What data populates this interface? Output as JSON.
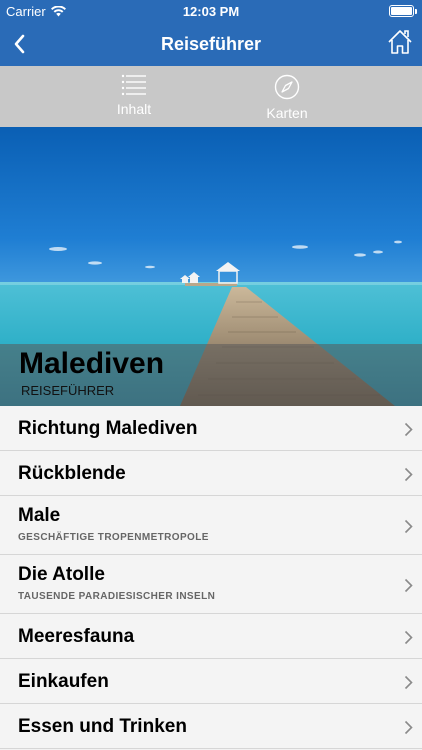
{
  "status_bar": {
    "carrier": "Carrier",
    "time": "12:03 PM",
    "battery_level": 1.0
  },
  "nav": {
    "title": "Reiseführer",
    "back_icon": "chevron-left-icon",
    "home_icon": "home-icon"
  },
  "toolbar": {
    "items": [
      {
        "label": "Inhalt",
        "icon": "list-icon"
      },
      {
        "label": "Karten",
        "icon": "compass-icon"
      }
    ]
  },
  "hero": {
    "title": "Malediven",
    "subtitle": "REISEFÜHRER"
  },
  "list": [
    {
      "title": "Richtung Malediven",
      "subtitle": ""
    },
    {
      "title": "Rückblende",
      "subtitle": ""
    },
    {
      "title": "Male",
      "subtitle": "GESCHÄFTIGE TROPENMETROPOLE"
    },
    {
      "title": "Die Atolle",
      "subtitle": "TAUSENDE PARADIESISCHER INSELN"
    },
    {
      "title": "Meeresfauna",
      "subtitle": ""
    },
    {
      "title": "Einkaufen",
      "subtitle": ""
    },
    {
      "title": "Essen und Trinken",
      "subtitle": ""
    }
  ],
  "colors": {
    "accent": "#2a6bb7",
    "toolbar": "#c8c8c8",
    "row_bg": "#f4f4f4",
    "separator": "#d6d6d6"
  }
}
